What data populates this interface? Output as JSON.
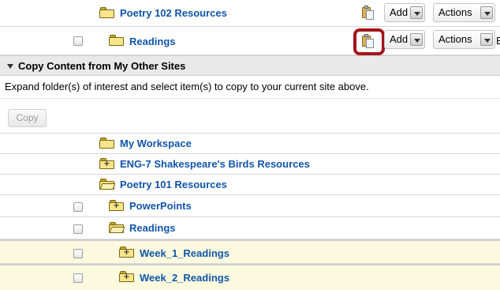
{
  "top_rows": [
    {
      "name": "Poetry 102 Resources",
      "add_label": "Add",
      "actions_label": "Actions"
    },
    {
      "name": "Readings",
      "add_label": "Add",
      "actions_label": "Actions",
      "cut_text": "E"
    }
  ],
  "copy_section": {
    "title": "Copy Content from My Other Sites",
    "instructions": "Expand folder(s) of interest and select item(s) to copy to your current site above.",
    "copy_button": "Copy"
  },
  "tree": [
    {
      "name": "My Workspace",
      "folder_state": "closed"
    },
    {
      "name": "ENG-7 Shakespeare's Birds Resources",
      "folder_state": "expandable"
    },
    {
      "name": "Poetry 101 Resources",
      "folder_state": "open"
    },
    {
      "name": "PowerPoints",
      "folder_state": "expandable"
    },
    {
      "name": "Readings",
      "folder_state": "open"
    },
    {
      "name": "Week_1_Readings",
      "folder_state": "expandable"
    },
    {
      "name": "Week_2_Readings",
      "folder_state": "expandable"
    }
  ],
  "icons": {
    "paste": "paste-icon",
    "folder": "folder-icon",
    "dropdown": "chevron-down-icon",
    "collapse": "triangle-down-icon"
  },
  "colors": {
    "link": "#1155aa",
    "highlight": "#a3141c",
    "selected_row": "#fbfadf",
    "section_header": "#e9e9e9"
  }
}
